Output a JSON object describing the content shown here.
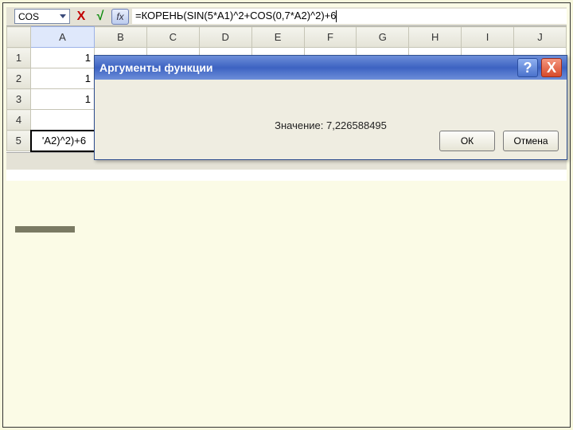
{
  "formula_bar": {
    "name_box_value": "COS",
    "cancel_glyph": "X",
    "enter_glyph": "√",
    "fx_label": "fx",
    "formula_text": "=КОРЕНЬ(SIN(5*A1)^2+COS(0,7*A2)^2)+6"
  },
  "columns": [
    "A",
    "B",
    "C",
    "D",
    "E",
    "F",
    "G",
    "H",
    "I",
    "J"
  ],
  "rows": [
    {
      "num": "1",
      "A": "1"
    },
    {
      "num": "2",
      "A": "1"
    },
    {
      "num": "3",
      "A": "1"
    },
    {
      "num": "4",
      "A": ""
    },
    {
      "num": "5",
      "A": "'A2)^2)+6"
    }
  ],
  "dialog": {
    "title": "Аргументы функции",
    "help_glyph": "?",
    "close_glyph": "X",
    "value_label": "Значение:",
    "value": "7,226588495",
    "ok_label": "ОК",
    "cancel_label": "Отмена"
  }
}
